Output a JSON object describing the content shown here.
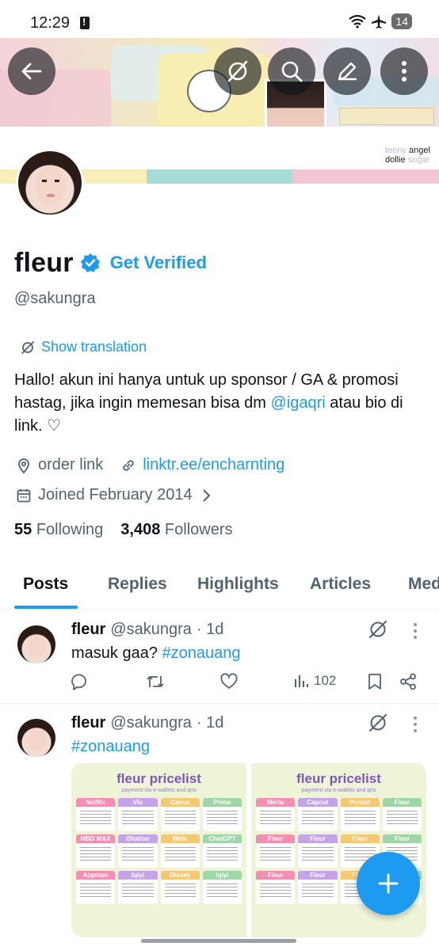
{
  "status_bar": {
    "time": "12:29",
    "battery": "14"
  },
  "profile": {
    "name": "fleur",
    "get_verified": "Get Verified",
    "handle": "@sakungra",
    "show_translation": "Show translation",
    "bio_text": "Hallo! akun ini hanya untuk up sponsor / GA & promosi hastag, jika ingin memesan bisa dm ",
    "bio_mention": "@igaqri",
    "bio_end": " atau bio di link. ♡",
    "location": "order link",
    "website": "linktr.ee/encharnting",
    "joined": "Joined February 2014",
    "following_count": "55",
    "following_label": "Following",
    "followers_count": "3,408",
    "followers_label": "Followers",
    "banner_brand": {
      "line1_a": "teeny",
      "line1_b": "angel",
      "line2_a": "dollie",
      "line2_b": "sugar"
    }
  },
  "tabs": [
    "Posts",
    "Replies",
    "Highlights",
    "Articles",
    "Media"
  ],
  "posts": [
    {
      "name": "fleur",
      "handle": "@sakungra",
      "time": "· 1d",
      "text": "masuk gaa?",
      "hashtag": "#zonauang",
      "views": "102"
    },
    {
      "name": "fleur",
      "handle": "@sakungra",
      "time": "· 1d",
      "hashtag": "#zonauang",
      "media": [
        {
          "title": "fleur pricelist",
          "subtitle": "payment via e-wallets and qris",
          "cells": [
            "Netflix",
            "Viu",
            "Canva",
            "Prime",
            "HBO MAX",
            "iStation",
            "Wetv",
            "ChatGPT",
            "Appmus",
            "Iqiyi",
            "Disney",
            "Iqiyi"
          ]
        },
        {
          "title": "fleur pricelist",
          "subtitle": "payment via e-wallets and qris",
          "cells": [
            "Meitu",
            "Capcut",
            "Picsart",
            "Fleur",
            "Fleur",
            "Fleur",
            "Fleur",
            "Fleur",
            "Fleur",
            "Fleur",
            "Fleur",
            "Fleur"
          ]
        }
      ]
    }
  ],
  "colors": {
    "accent": "#1d9bf0",
    "text": "#0f1419",
    "muted": "#536471",
    "stripe_yellow": "#f7eeb9",
    "stripe_mint": "#a7dcd9",
    "stripe_pink": "#f4c6d3"
  }
}
